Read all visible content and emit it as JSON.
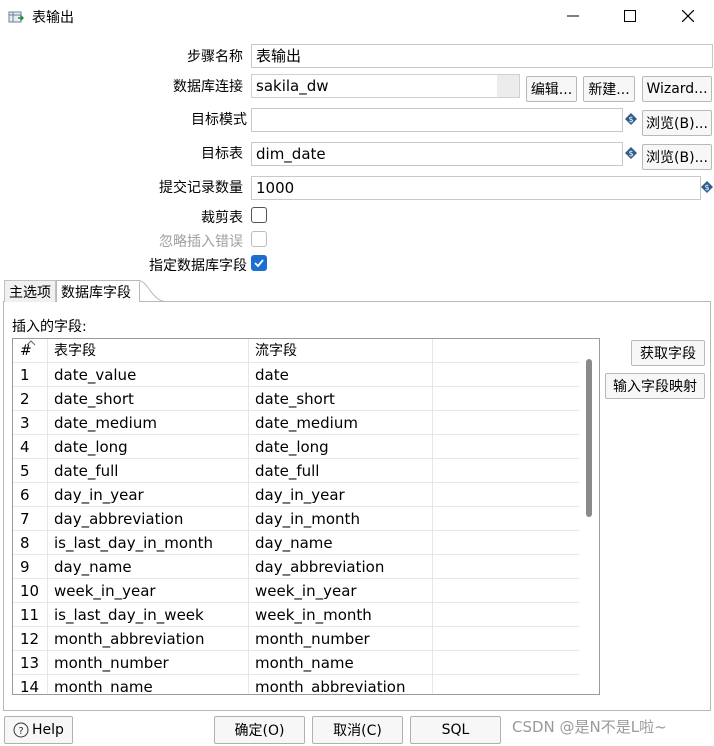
{
  "window": {
    "title": "表输出",
    "icon": "table-output-icon",
    "controls": [
      "minimize-icon",
      "maximize-icon",
      "close-icon"
    ]
  },
  "form": {
    "step_name": {
      "label": "步骤名称",
      "value": "表输出"
    },
    "db_connection": {
      "label": "数据库连接",
      "value": "sakila_dw",
      "edit_btn": "编辑...",
      "new_btn": "新建...",
      "wizard_btn": "Wizard..."
    },
    "target_schema": {
      "label": "目标模式",
      "value": "",
      "browse_btn": "浏览(B)..."
    },
    "target_table": {
      "label": "目标表",
      "value": "dim_date",
      "browse_btn": "浏览(B)..."
    },
    "commit_size": {
      "label": "提交记录数量",
      "value": "1000"
    },
    "truncate": {
      "label": "裁剪表",
      "checked": false
    },
    "ignore_errors": {
      "label": "忽略插入错误",
      "checked": false,
      "disabled": true
    },
    "specify_fields": {
      "label": "指定数据库字段",
      "checked": true
    }
  },
  "tabs": [
    {
      "label": "主选项",
      "active": false
    },
    {
      "label": "数据库字段",
      "active": true
    }
  ],
  "fields_panel": {
    "title": "插入的字段:",
    "get_fields_btn": "获取字段",
    "mapping_btn": "输入字段映射",
    "columns": [
      "#",
      "表字段",
      "流字段"
    ],
    "rows": [
      {
        "n": "1",
        "table_field": "date_value",
        "stream_field": "date"
      },
      {
        "n": "2",
        "table_field": "date_short",
        "stream_field": "date_short"
      },
      {
        "n": "3",
        "table_field": "date_medium",
        "stream_field": "date_medium"
      },
      {
        "n": "4",
        "table_field": "date_long",
        "stream_field": "date_long"
      },
      {
        "n": "5",
        "table_field": "date_full",
        "stream_field": "date_full"
      },
      {
        "n": "6",
        "table_field": "day_in_year",
        "stream_field": "day_in_year"
      },
      {
        "n": "7",
        "table_field": "day_abbreviation",
        "stream_field": "day_in_month"
      },
      {
        "n": "8",
        "table_field": "is_last_day_in_month",
        "stream_field": "day_name"
      },
      {
        "n": "9",
        "table_field": "day_name",
        "stream_field": "day_abbreviation"
      },
      {
        "n": "10",
        "table_field": "week_in_year",
        "stream_field": "week_in_year"
      },
      {
        "n": "11",
        "table_field": "is_last_day_in_week",
        "stream_field": "week_in_month"
      },
      {
        "n": "12",
        "table_field": "month_abbreviation",
        "stream_field": "month_number"
      },
      {
        "n": "13",
        "table_field": "month_number",
        "stream_field": "month_name"
      },
      {
        "n": "14",
        "table_field": "month_name",
        "stream_field": "month_abbreviation"
      }
    ]
  },
  "footer": {
    "help_btn": "Help",
    "ok_btn": "确定(O)",
    "cancel_btn": "取消(C)",
    "sql_btn": "SQL",
    "watermark": "CSDN @是N不是L啦~"
  },
  "colors": {
    "accent": "#1a6fcf",
    "variable_icon": "#2f5d8c",
    "disabled_text": "#a0a0a0"
  }
}
